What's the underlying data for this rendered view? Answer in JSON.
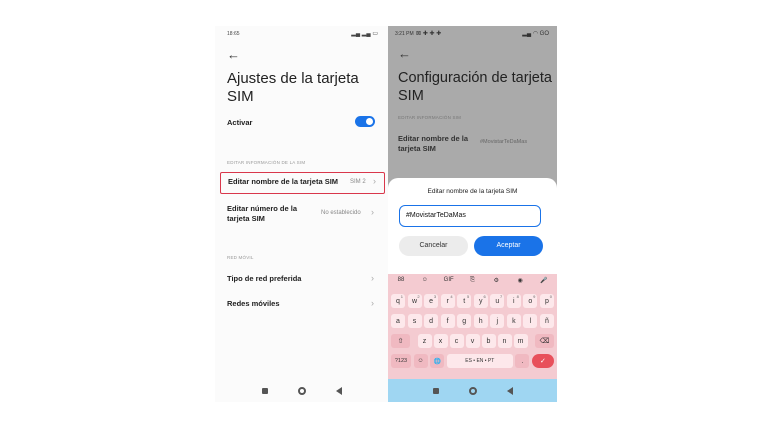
{
  "left": {
    "status_time": "18:65",
    "back_glyph": "←",
    "title": "Ajustes de la tarjeta SIM",
    "activar_label": "Activar",
    "section_edit": "EDITAR INFORMACIÓN DE LA SIM",
    "edit_name_label": "Editar nombre de la tarjeta SIM",
    "edit_name_value": "SIM 2",
    "edit_number_label": "Editar número de la tarjeta SIM",
    "edit_number_value": "No establecido",
    "section_network": "RED MÓVIL",
    "network_type_label": "Tipo de red preferida",
    "mobile_networks_label": "Redes móviles",
    "chevron": "›"
  },
  "right": {
    "status_time": "3:21 PM",
    "status_right": "GO",
    "back_glyph": "←",
    "title": "Configuración de tarjeta SIM",
    "section_edit": "EDITAR INFORMACIÓN SIM",
    "edit_name_label": "Editar nombre de la tarjeta SIM",
    "edit_name_value": "#MovistarTeDaMas",
    "dialog": {
      "title": "Editar nombre de la tarjeta SIM",
      "input_value": "#MovistarTeDaMas",
      "cancel_label": "Cancelar",
      "accept_label": "Aceptar"
    },
    "keyboard": {
      "toolbar": [
        "88",
        "☺",
        "GIF",
        "⎘",
        "⚙",
        "◉",
        "🎤"
      ],
      "row1": [
        {
          "k": "q",
          "s": "1"
        },
        {
          "k": "w",
          "s": "2"
        },
        {
          "k": "e",
          "s": "3"
        },
        {
          "k": "r",
          "s": "4"
        },
        {
          "k": "t",
          "s": "5"
        },
        {
          "k": "y",
          "s": "6"
        },
        {
          "k": "u",
          "s": "7"
        },
        {
          "k": "i",
          "s": "8"
        },
        {
          "k": "o",
          "s": "9"
        },
        {
          "k": "p",
          "s": "0"
        }
      ],
      "row2": [
        "a",
        "s",
        "d",
        "f",
        "g",
        "h",
        "j",
        "k",
        "l",
        "ñ"
      ],
      "row3": [
        "z",
        "x",
        "c",
        "v",
        "b",
        "n",
        "m"
      ],
      "shift": "⇧",
      "backspace": "⌫",
      "symbols": "?123",
      "emoji": "☺",
      "globe": "🌐",
      "space": "ES • EN • PT",
      "period": ".",
      "enter": "✓"
    }
  }
}
